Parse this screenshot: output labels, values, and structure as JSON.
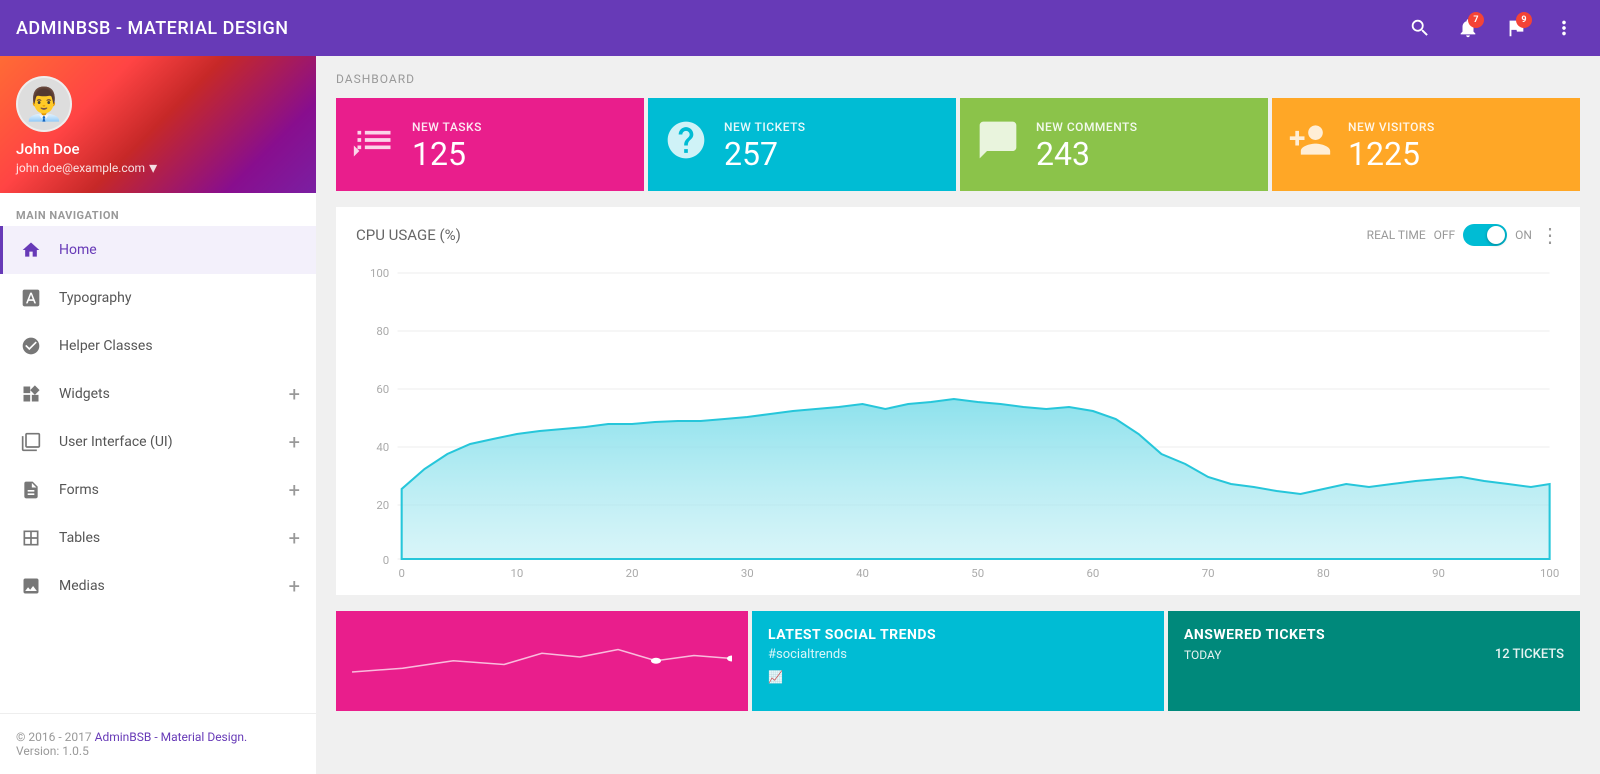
{
  "app": {
    "title": "ADMINBSB - MATERIAL DESIGN"
  },
  "topnav": {
    "title": "ADMINBSB - MATERIAL DESIGN",
    "notification_badge": "7",
    "flag_badge": "9"
  },
  "sidebar": {
    "user": {
      "name": "John Doe",
      "email": "john.doe@example.com"
    },
    "nav_label": "MAIN NAVIGATION",
    "items": [
      {
        "id": "home",
        "label": "Home",
        "icon": "🏠",
        "active": true
      },
      {
        "id": "typography",
        "label": "Typography",
        "icon": "T↕",
        "active": false
      },
      {
        "id": "helper-classes",
        "label": "Helper Classes",
        "icon": "◆",
        "active": false
      },
      {
        "id": "widgets",
        "label": "Widgets",
        "icon": "⊞",
        "active": false,
        "has_plus": true
      },
      {
        "id": "ui",
        "label": "User Interface (UI)",
        "icon": "◻",
        "active": false,
        "has_plus": true
      },
      {
        "id": "forms",
        "label": "Forms",
        "icon": "☰",
        "active": false,
        "has_plus": true
      },
      {
        "id": "tables",
        "label": "Tables",
        "icon": "⊟",
        "active": false,
        "has_plus": true
      },
      {
        "id": "medias",
        "label": "Medias",
        "icon": "🖼",
        "active": false,
        "has_plus": true
      }
    ],
    "footer": {
      "text": "© 2016 - 2017 ",
      "link_text": "AdminBSB - Material Design.",
      "version": "Version: 1.0.5"
    }
  },
  "main": {
    "breadcrumb": "DASHBOARD",
    "stat_cards": [
      {
        "id": "tasks",
        "label": "NEW TASKS",
        "value": "125",
        "color": "pink",
        "icon": "task"
      },
      {
        "id": "tickets",
        "label": "NEW TICKETS",
        "value": "257",
        "color": "teal",
        "icon": "help"
      },
      {
        "id": "comments",
        "label": "NEW COMMENTS",
        "value": "243",
        "color": "green",
        "icon": "comment"
      },
      {
        "id": "visitors",
        "label": "NEW VISITORS",
        "value": "1225",
        "color": "orange",
        "icon": "person_add"
      }
    ],
    "chart": {
      "title": "CPU USAGE (%)",
      "realtime_label": "REAL TIME",
      "off_label": "OFF",
      "on_label": "ON",
      "y_labels": [
        "100",
        "80",
        "60",
        "40",
        "20",
        "0"
      ],
      "x_labels": [
        "0",
        "10",
        "20",
        "30",
        "40",
        "50",
        "60",
        "70",
        "80",
        "90",
        "100"
      ]
    },
    "bottom_cards": [
      {
        "id": "trends-pink",
        "color": "pink",
        "has_sparkline": true
      },
      {
        "id": "social-trends",
        "color": "teal",
        "title": "LATEST SOCIAL TRENDS",
        "subtitle": "#socialtrends"
      },
      {
        "id": "answered-tickets",
        "color": "dark-teal",
        "title": "ANSWERED TICKETS",
        "subtitle": "TODAY",
        "count": "12 TICKETS"
      }
    ]
  }
}
